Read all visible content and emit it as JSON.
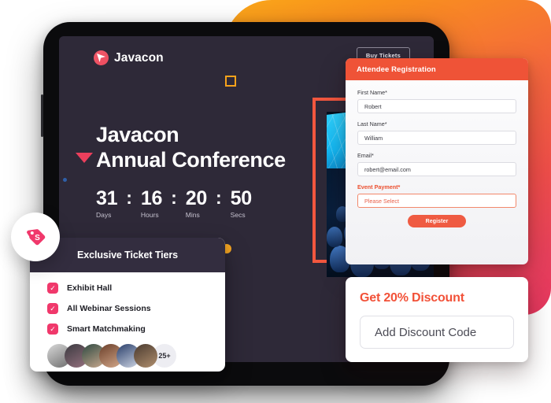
{
  "background": {
    "gradient_from": "#FBA919",
    "gradient_mid": "#F4683C",
    "gradient_to": "#E5375F"
  },
  "tablet": {
    "screen_bg": "#2E2938",
    "site": {
      "brand": {
        "name": "Javacon",
        "mark_icon": "javacon-play-mark",
        "mark_color": "#EE4B5E"
      },
      "buy_tickets_label": "Buy Tickets",
      "hero": {
        "headline": "Javacon\nAnnual Conference",
        "countdown": [
          {
            "value": "31",
            "label": "Days"
          },
          {
            "value": "16",
            "label": "Hours"
          },
          {
            "value": "20",
            "label": "Mins"
          },
          {
            "value": "50",
            "label": "Secs"
          }
        ],
        "separator": ":"
      },
      "hero_image": {
        "alt": "conference-hall-audience",
        "frame_color": "#F2573F"
      },
      "decorations": {
        "square_color": "#F7A21B",
        "triangle_color": "#EC3F5C",
        "dot_blue_color": "#2f5fa8",
        "dot_orange_color": "#F5A623"
      }
    }
  },
  "registration": {
    "header_title": "Attendee Registration",
    "header_color": "#EF5337",
    "fields": [
      {
        "label": "First Name*",
        "value": "Robert",
        "required_highlight": false
      },
      {
        "label": "Last Name*",
        "value": "William",
        "required_highlight": false
      },
      {
        "label": "Email*",
        "value": "robert@email.com",
        "required_highlight": false
      },
      {
        "label": "Event Payment*",
        "value": "Please Select",
        "required_highlight": true
      }
    ],
    "submit_label": "Register",
    "submit_color": "#EF5B42"
  },
  "discount": {
    "title": "Get 20% Discount",
    "title_color": "#F25138",
    "input_placeholder": "Add Discount Code"
  },
  "ticket_tiers": {
    "badge_icon": "price-tag-icon",
    "badge_color": "#F0386B",
    "title": "Exclusive Ticket Tiers",
    "check_color": "#F0386B",
    "check_glyph": "✓",
    "items": [
      {
        "label": "Exhibit Hall"
      },
      {
        "label": "All Webinar Sessions"
      },
      {
        "label": "Smart Matchmaking"
      }
    ],
    "avatars": [
      {
        "name": "attendee-1",
        "c1": "#d9d9d9",
        "c2": "#6e6e6e"
      },
      {
        "name": "attendee-2",
        "c1": "#3b3a40",
        "c2": "#96717f"
      },
      {
        "name": "attendee-3",
        "c1": "#2f4a42",
        "c2": "#c9a98e"
      },
      {
        "name": "attendee-4",
        "c1": "#6b3f2a",
        "c2": "#d4a98b"
      },
      {
        "name": "attendee-5",
        "c1": "#2a3f6b",
        "c2": "#cfd6e4"
      },
      {
        "name": "attendee-6",
        "c1": "#4a3a2f",
        "c2": "#b08f6e"
      }
    ],
    "more_count": "25+"
  }
}
